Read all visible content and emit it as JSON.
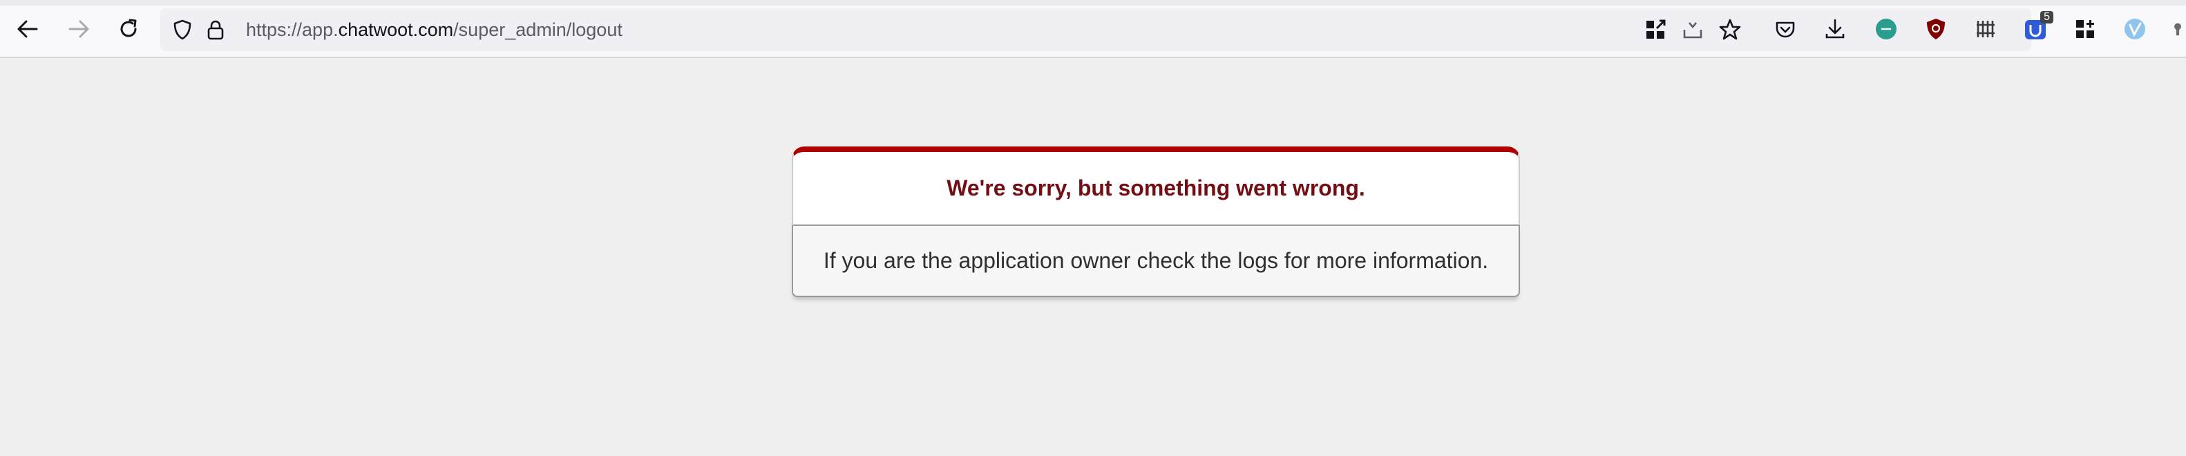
{
  "browser": {
    "url": {
      "prefix": "https://app.",
      "host": "chatwoot.com",
      "path": "/super_admin/logout"
    },
    "toolbar_icons": [
      "qr-code-icon",
      "save-to-pocket-icon",
      "bookmark-star-icon",
      "pocket-icon",
      "download-icon",
      "extension-green-icon",
      "ublock-icon",
      "extension-grid-bars-icon",
      "extension-u-icon",
      "extensions-grid-icon",
      "extension-v-icon"
    ],
    "extension_badge": "5"
  },
  "error": {
    "title": "We're sorry, but something went wrong.",
    "message": "If you are the application owner check the logs for more information."
  },
  "colors": {
    "accent_bar": "#b00100",
    "title": "#730e15",
    "page_bg": "#efefef"
  }
}
